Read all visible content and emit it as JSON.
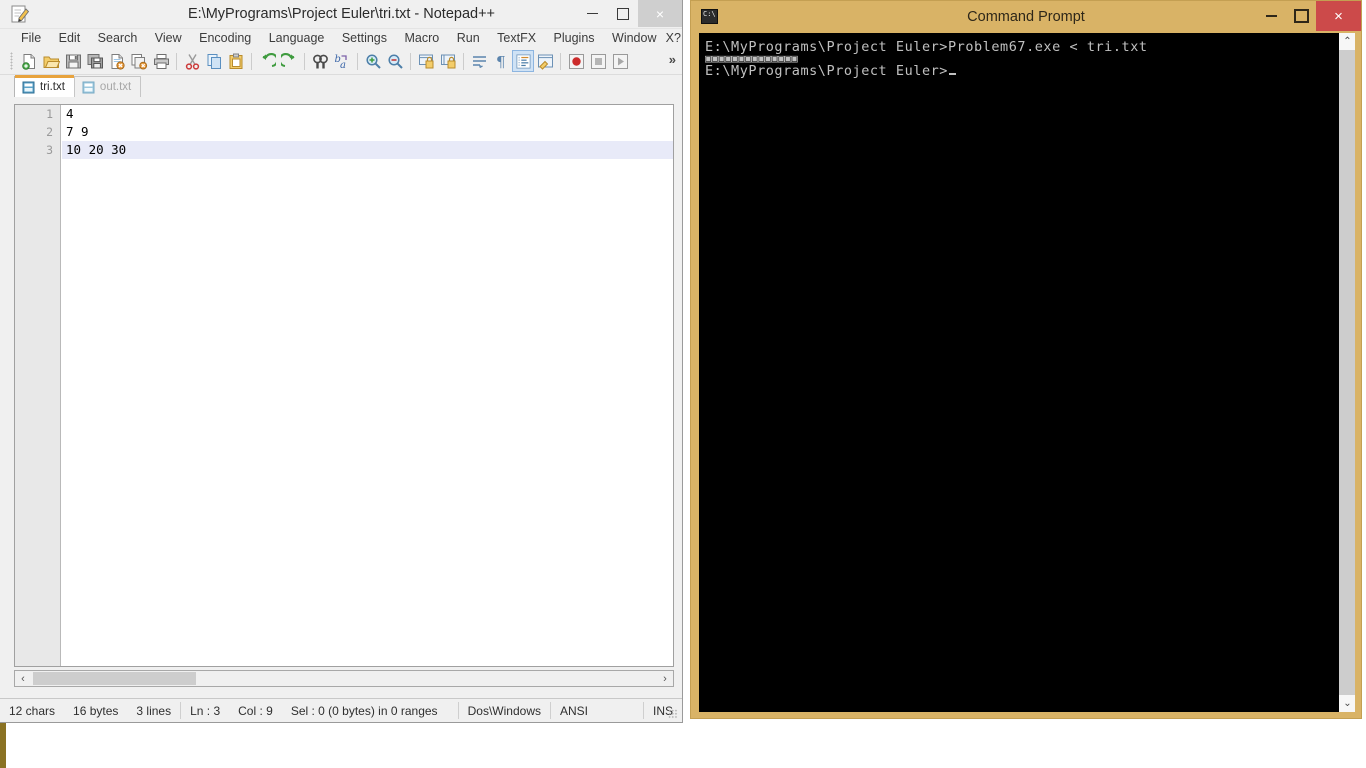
{
  "notepadpp": {
    "title": "E:\\MyPrograms\\Project Euler\\tri.txt - Notepad++",
    "app_icon": "notepad-pencil-icon",
    "window_controls": {
      "minimize": "minimize-icon",
      "maximize": "maximize-icon",
      "close": "×"
    },
    "menu": [
      "File",
      "Edit",
      "Search",
      "View",
      "Encoding",
      "Language",
      "Settings",
      "Macro",
      "Run",
      "TextFX",
      "Plugins",
      "Window",
      "?"
    ],
    "menu_close_label": "X",
    "toolbar": {
      "overflow_label": "»",
      "buttons": [
        {
          "name": "new-file-icon",
          "group": 1
        },
        {
          "name": "open-file-icon",
          "group": 1
        },
        {
          "name": "save-icon",
          "group": 1
        },
        {
          "name": "save-all-icon",
          "group": 1
        },
        {
          "name": "close-file-icon",
          "group": 1
        },
        {
          "name": "close-all-files-icon",
          "group": 1
        },
        {
          "name": "print-icon",
          "group": 1
        },
        {
          "name": "cut-icon",
          "group": 2
        },
        {
          "name": "copy-icon",
          "group": 2
        },
        {
          "name": "paste-icon",
          "group": 2
        },
        {
          "name": "undo-icon",
          "group": 3
        },
        {
          "name": "redo-icon",
          "group": 3
        },
        {
          "name": "find-icon",
          "group": 4
        },
        {
          "name": "replace-icon",
          "group": 4
        },
        {
          "name": "zoom-in-icon",
          "group": 5
        },
        {
          "name": "zoom-out-icon",
          "group": 5
        },
        {
          "name": "sync-vertical-scroll-icon",
          "group": 6
        },
        {
          "name": "sync-horizontal-scroll-icon",
          "group": 6
        },
        {
          "name": "word-wrap-icon",
          "group": 7
        },
        {
          "name": "show-all-characters-icon",
          "group": 7
        },
        {
          "name": "indent-guide-icon",
          "group": 7,
          "active": true
        },
        {
          "name": "user-defined-dialog-icon",
          "group": 7
        },
        {
          "name": "record-macro-icon",
          "group": 8
        },
        {
          "name": "stop-recording-macro-icon",
          "group": 8
        },
        {
          "name": "playback-macro-icon",
          "group": 8
        }
      ]
    },
    "tabs": [
      {
        "label": "tri.txt",
        "active": true,
        "icon": "saved-document-icon"
      },
      {
        "label": "out.txt",
        "active": false,
        "icon": "saved-document-icon"
      }
    ],
    "editor": {
      "line_numbers": [
        "1",
        "2",
        "3"
      ],
      "lines": [
        "4",
        "7 9",
        "10 20 30"
      ],
      "current_line_index": 2
    },
    "hscrollbar": {
      "left_arrow": "‹",
      "right_arrow": "›"
    },
    "statusbar": {
      "chars": "12 chars",
      "bytes": "16 bytes",
      "lines": "3 lines",
      "ln": "Ln : 3",
      "col": "Col : 9",
      "sel": "Sel : 0 (0 bytes) in 0 ranges",
      "eol": "Dos\\Windows",
      "encoding": "ANSI",
      "insert_mode": "INS"
    }
  },
  "command_prompt": {
    "title": "Command Prompt",
    "app_icon": "cmd-console-icon",
    "icon_text": "C:\\",
    "window_controls": {
      "minimize": "minimize-icon",
      "maximize": "maximize-icon",
      "close": "×"
    },
    "console_lines": [
      "E:\\MyPrograms\\Project Euler>Problem67.exe < tri.txt",
      "▣▣▣▣▣▣▣▣▣▣▣▣▣▣",
      "E:\\MyPrograms\\Project Euler>"
    ],
    "scrollbar": {
      "up_arrow": "⌃",
      "down_arrow": "⌄"
    }
  },
  "colors": {
    "cmd_titlebar": "#d9b366",
    "cmd_close": "#cc4a4a",
    "npp_tab_accent": "#e8a33d",
    "current_line_highlight": "#e8eaf8",
    "console_text": "#c0c0c0",
    "console_bg": "#000000"
  }
}
